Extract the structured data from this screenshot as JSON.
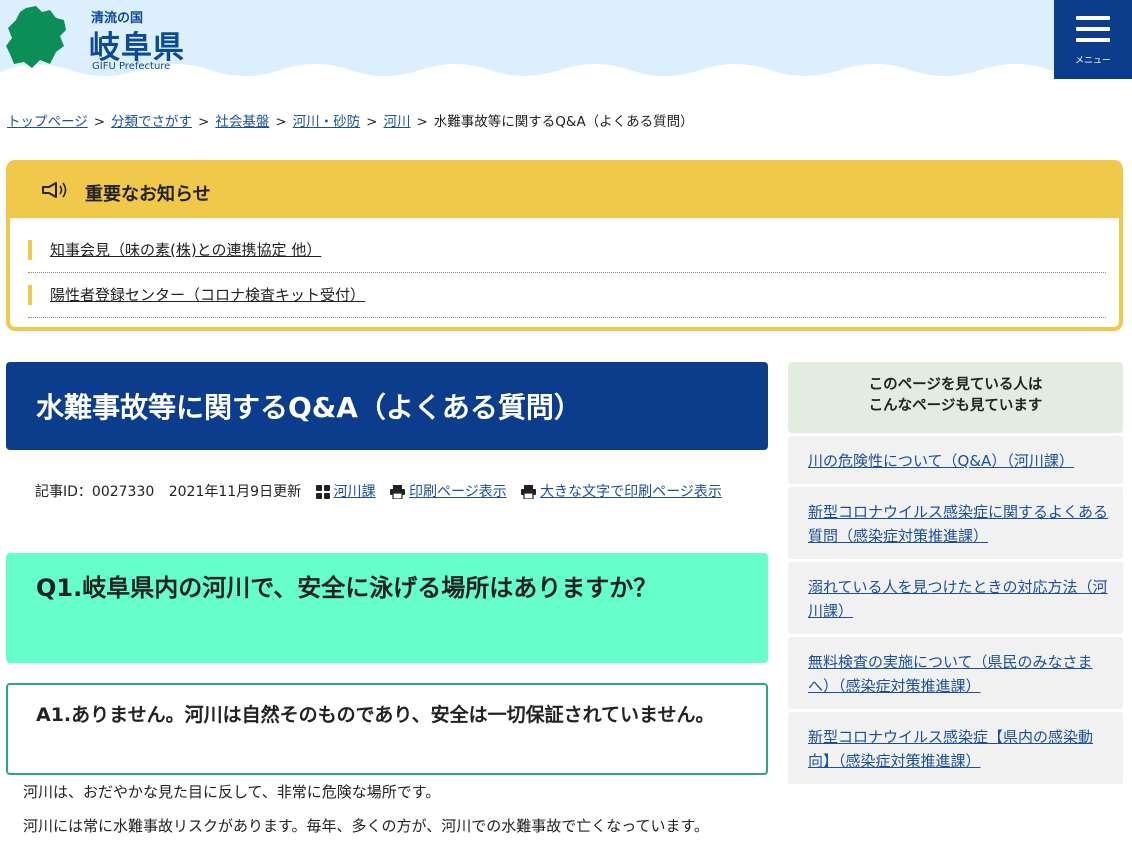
{
  "header": {
    "logo_tagline": "清流の国",
    "logo_name": "岐阜県",
    "logo_en": "GIFU Prefecture",
    "menu_label": "メニュー",
    "colors": {
      "header_bg": "#dcefff",
      "navy": "#0c3d8d",
      "logo_green": "#0b8f57"
    }
  },
  "breadcrumb": {
    "links": [
      "トップページ",
      "分類でさがす",
      "社会基盤",
      "河川・砂防",
      "河川"
    ],
    "separator": ">",
    "current": "水難事故等に関するQ&A（よくある質問）"
  },
  "notice": {
    "title": "重要なお知らせ",
    "icon": "megaphone-icon",
    "items": [
      "知事会見（味の素(株)との連携協定 他）",
      "陽性者登録センター（コロナ検査キット受付）"
    ],
    "accent": "#f0c84a"
  },
  "article": {
    "title": "水難事故等に関するQ&A（よくある質問）",
    "meta": {
      "id_text": "記事ID：0027330",
      "updated": "2021年11月9日更新",
      "section": "河川課",
      "print": "印刷ページ表示",
      "print_large": "大きな文字で印刷ページ表示"
    },
    "question": "Q1.岐阜県内の河川で、安全に泳げる場所はありますか？",
    "answer": "A1.ありません。河川は自然そのものであり、安全は一切保証されていません。",
    "paragraphs": [
      "河川は、おだやかな見た目に反して、非常に危険な場所です。",
      "河川には常に水難事故リスクがあります。毎年、多くの方が、河川での水難事故で亡くなっています。"
    ],
    "colors": {
      "question_bg": "#66ffcc",
      "answer_border": "#2aa584"
    }
  },
  "sidebar": {
    "heading_line1": "このページを見ている人は",
    "heading_line2": "こんなページも見ています",
    "links": [
      "川の危険性について（Q&A）（河川課）",
      "新型コロナウイルス感染症に関するよくある質問（感染症対策推進課）",
      "溺れている人を見つけたときの対応方法（河川課）",
      "無料検査の実施について（県民のみなさまへ）（感染症対策推進課）",
      "新型コロナウイルス感染症【県内の感染動向】（感染症対策推進課）"
    ]
  }
}
